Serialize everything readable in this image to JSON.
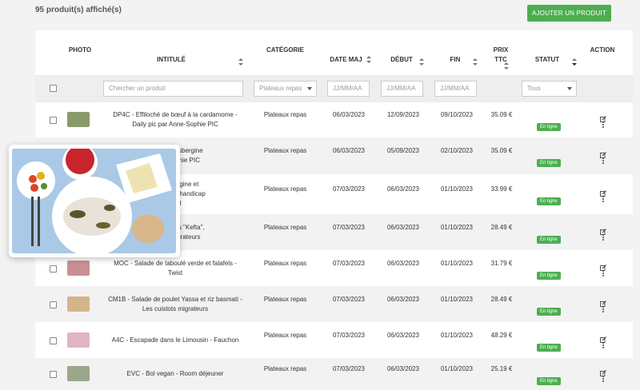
{
  "header": {
    "count_label": "95 produit(s) affiché(s)",
    "add_button": "AJOUTER UN PRODUIT"
  },
  "colors": {
    "accent": "#4cae4f",
    "status_online": "#4caf50",
    "row_alt": "#f2f2f2"
  },
  "table": {
    "columns": {
      "photo": "PHOTO",
      "title": "INTITULÉ",
      "category": "CATÉGORIE",
      "date_maj": "DATE MAJ",
      "debut": "DÉBUT",
      "fin": "FIN",
      "prix_1": "PRIX",
      "prix_2": "TTC",
      "statut": "STATUT",
      "action": "ACTION"
    },
    "filters": {
      "search_placeholder": "Chercher un produit",
      "category_selected": "Plateaux repas",
      "date_maj_placeholder": "JJ/MM/AA",
      "debut_placeholder": "JJ/MM/AA",
      "fin_placeholder": "JJ/MM/AA",
      "status_selected": "Tous"
    },
    "rows": [
      {
        "title_1": "DP4C - Effiloché de bœuf à la cardamome -",
        "title_2": "Daily pic par Anne-Sophie PIC",
        "category": "Plateaux repas",
        "date_maj": "06/03/2023",
        "debut": "12/09/2023",
        "fin": "09/10/2023",
        "prix": "35.09 €",
        "status": "En ligne"
      },
      {
        "title_1": "Sébaste, aubergine",
        "title_2": "Anne-Sophie PIC",
        "category": "Plateaux repas",
        "date_maj": "06/03/2023",
        "debut": "05/09/2023",
        "fin": "02/10/2023",
        "prix": "35.09 €",
        "status": "En ligne"
      },
      {
        "title_1": "ille, aubergine et",
        "title_2": "n saveurs x handicap",
        "title_3": "onal",
        "category": "Plateaux repas",
        "date_maj": "07/03/2023",
        "debut": "06/03/2023",
        "fin": "01/10/2023",
        "prix": "33.99 €",
        "status": "En ligne"
      },
      {
        "title_1": "uf et agneau \"Kefta\",",
        "title_2": "uistots migrateurs",
        "category": "Plateaux repas",
        "date_maj": "07/03/2023",
        "debut": "06/03/2023",
        "fin": "01/10/2023",
        "prix": "28.49 €",
        "status": "En ligne"
      },
      {
        "title_1": "MOC - Salade de taboulé verde et falafels -",
        "title_2": "Twist",
        "category": "Plateaux repas",
        "date_maj": "07/03/2023",
        "debut": "06/03/2023",
        "fin": "01/10/2023",
        "prix": "31.79 €",
        "status": "En ligne"
      },
      {
        "title_1": "CM1B - Salade de poulet Yassa et riz basmati -",
        "title_2": "Les cuistots migrateurs",
        "category": "Plateaux repas",
        "date_maj": "07/03/2023",
        "debut": "06/03/2023",
        "fin": "01/10/2023",
        "prix": "28.49 €",
        "status": "En ligne"
      },
      {
        "title_1": "A4C - Escapade dans le Limousin - Fauchon",
        "title_2": "",
        "category": "Plateaux repas",
        "date_maj": "07/03/2023",
        "debut": "06/03/2023",
        "fin": "01/10/2023",
        "prix": "48.29 €",
        "status": "En ligne"
      },
      {
        "title_1": "EVC - Bol vegan - Room déjeuner",
        "title_2": "",
        "category": "Plateaux repas",
        "date_maj": "07/03/2023",
        "debut": "06/03/2023",
        "fin": "01/10/2023",
        "prix": "25.19 €",
        "status": "En ligne"
      }
    ]
  },
  "icons": {
    "edit": "edit-icon",
    "more": "more-vertical-icon",
    "sort": "sort-icon"
  }
}
